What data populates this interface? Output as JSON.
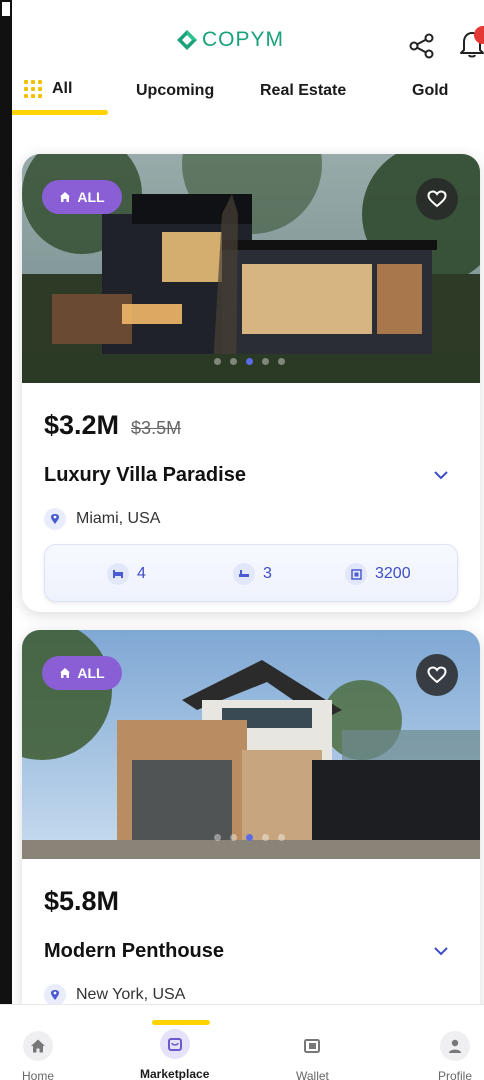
{
  "header": {
    "logo_text": "COPYM",
    "brand_color": "#1aa37a"
  },
  "tabs": [
    {
      "label": "All",
      "active": true
    },
    {
      "label": "Upcoming",
      "active": false
    },
    {
      "label": "Real Estate",
      "active": false
    },
    {
      "label": "Gold",
      "active": false
    }
  ],
  "listings": [
    {
      "badge": "ALL",
      "price": "$3.2M",
      "old_price": "$3.5M",
      "title": "Luxury Villa Paradise",
      "location": "Miami, USA",
      "beds": "4",
      "baths": "3",
      "area": "3200",
      "image_index": 3,
      "image_count": 5
    },
    {
      "badge": "ALL",
      "price": "$5.8M",
      "title": "Modern Penthouse",
      "location": "New York, USA",
      "image_index": 3,
      "image_count": 5
    }
  ],
  "bottom_nav": [
    {
      "label": "Home",
      "icon": "home-icon",
      "active": false
    },
    {
      "label": "Marketplace",
      "icon": "marketplace-icon",
      "active": true
    },
    {
      "label": "Wallet",
      "icon": "wallet-icon",
      "active": false
    },
    {
      "label": "Profile",
      "icon": "profile-icon",
      "active": false
    }
  ],
  "colors": {
    "accent": "#ffd400",
    "badge": "#8a5fd6",
    "spec_text": "#3d4ec7",
    "active_dot": "#5b6be8"
  }
}
